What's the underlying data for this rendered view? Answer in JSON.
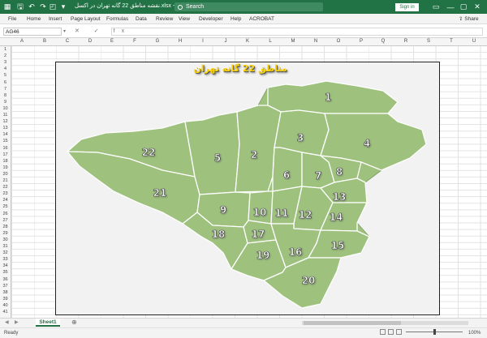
{
  "titlebar": {
    "title": "نقشه مناطق 22 گانه تهران در اکسل.xlsx  -  Excel",
    "search_placeholder": "Search",
    "signin_label": "Sign in",
    "autosave_icon": "save-icon",
    "undo_icon": "undo-icon",
    "redo_icon": "redo-icon",
    "accent": "#217346"
  },
  "ribbon": {
    "tabs": [
      "File",
      "Home",
      "Insert",
      "Page Layout",
      "Formulas",
      "Data",
      "Review",
      "View",
      "Developer",
      "Help",
      "ACROBAT"
    ],
    "share_label": "Share"
  },
  "formula_bar": {
    "name_box": "AG46",
    "fx_label": "✕ ✓ fx",
    "value": ""
  },
  "columns": [
    "A",
    "B",
    "C",
    "D",
    "E",
    "F",
    "G",
    "H",
    "I",
    "J",
    "K",
    "L",
    "M",
    "N",
    "O",
    "P",
    "Q",
    "R",
    "S",
    "T",
    "U"
  ],
  "rows": [
    "1",
    "2",
    "3",
    "4",
    "5",
    "6",
    "7",
    "8",
    "9",
    "10",
    "11",
    "12",
    "13",
    "14",
    "15",
    "16",
    "17",
    "18",
    "19",
    "20",
    "21",
    "22",
    "23",
    "24",
    "25",
    "26",
    "27",
    "28",
    "29",
    "30",
    "31",
    "32",
    "33",
    "34",
    "35",
    "36",
    "37",
    "38",
    "39",
    "40",
    "41"
  ],
  "map": {
    "title": "مناطق 22 گانه تهران",
    "fill_color": "#9ec27e",
    "border_color": "#ffffff",
    "districts": [
      "1",
      "2",
      "3",
      "4",
      "5",
      "6",
      "7",
      "8",
      "9",
      "10",
      "11",
      "12",
      "13",
      "14",
      "15",
      "16",
      "17",
      "18",
      "19",
      "20",
      "21",
      "22"
    ]
  },
  "sheets": [
    "Sheet1"
  ],
  "status": {
    "ready": "Ready",
    "zoom": "100%"
  }
}
